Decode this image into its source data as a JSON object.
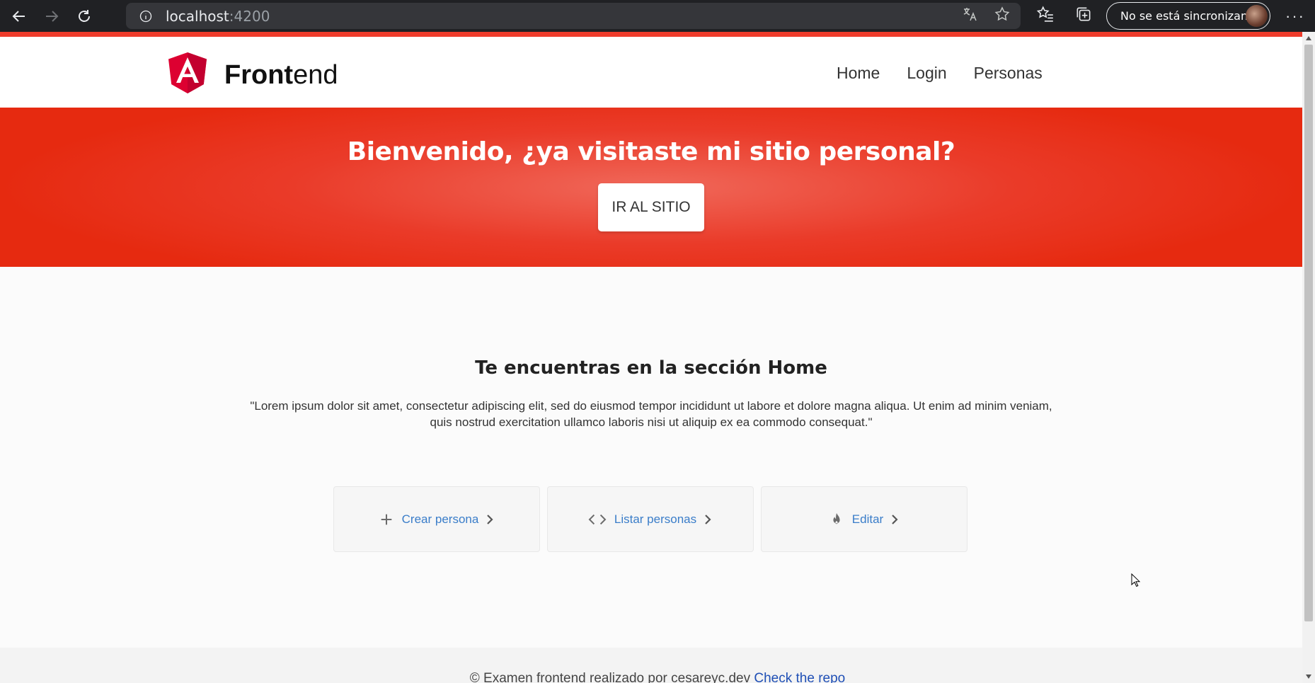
{
  "browser": {
    "url_host": "localhost",
    "url_port": ":4200",
    "sync_label": "No se está sincronizando",
    "icons": [
      "back-arrow-icon",
      "forward-arrow-icon",
      "refresh-icon",
      "info-icon",
      "translate-icon",
      "star-icon",
      "favorites-icon",
      "collections-icon",
      "more-icon"
    ]
  },
  "header": {
    "brand_bold": "Front",
    "brand_rest": "end",
    "nav": [
      "Home",
      "Login",
      "Personas"
    ]
  },
  "hero": {
    "title": "Bienvenido, ¿ya visitaste mi sitio personal?",
    "button_label": "IR AL SITIO"
  },
  "main": {
    "section_title": "Te encuentras en la sección Home",
    "lorem_line1": "\"Lorem ipsum dolor sit amet, consectetur adipiscing elit, sed do eiusmod tempor incididunt ut labore et dolore magna aliqua. Ut enim ad minim veniam,",
    "lorem_line2": "quis nostrud exercitation ullamco laboris nisi ut aliquip ex ea commodo consequat.\"",
    "cards": [
      {
        "label": "Crear persona",
        "icon": "plus-icon"
      },
      {
        "label": "Listar personas",
        "icon": "code-icon"
      },
      {
        "label": "Editar",
        "icon": "fire-icon"
      }
    ]
  },
  "footer": {
    "text": "© Examen frontend realizado por cesareyc.dev",
    "link": "Check the repo"
  },
  "colors": {
    "accent": "#ea3b29",
    "link": "#3a7dc9",
    "chrome": "#202124"
  }
}
